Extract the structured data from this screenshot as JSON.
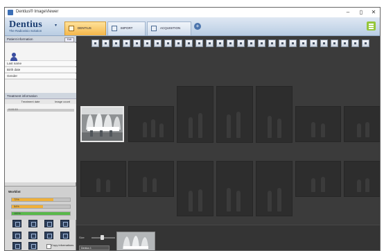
{
  "window": {
    "title": "Dentius® ImageViewer"
  },
  "logo": {
    "name": "Dentius",
    "subtitle": "The Radiovisio Solution"
  },
  "tabs": [
    {
      "label": "Dentius",
      "active": true
    },
    {
      "label": "Import",
      "active": false
    },
    {
      "label": "Acquisition",
      "active": false
    }
  ],
  "patient": {
    "header": "Patient information",
    "edit_label": "Edit",
    "fields": [
      "Last name",
      "Birth date",
      "Gender"
    ]
  },
  "treatment": {
    "header": "Treatment information",
    "columns": [
      "Treatment date",
      "Image count"
    ],
    "row": "01/01/15"
  },
  "worklist": {
    "title": "Worklist",
    "bars": [
      {
        "value": 72,
        "color": "#f0b13a"
      },
      {
        "value": 54,
        "color": "#f0b13a"
      },
      {
        "value": 100,
        "color": "#59b84a"
      }
    ]
  },
  "options": {
    "checkbox_label": "Copy informations"
  },
  "strip": {
    "zoom_label": "Size",
    "field_text": "Dentius 1"
  },
  "colors": {
    "active_tab": "#f4b64a",
    "ribbon": "#c6d6e8",
    "image_bg": "#3b3b3b"
  },
  "icons": [
    "window-minimize-icon",
    "window-maximize-icon",
    "window-close-icon",
    "menu-icon",
    "person-icon",
    "add-tab-icon"
  ]
}
